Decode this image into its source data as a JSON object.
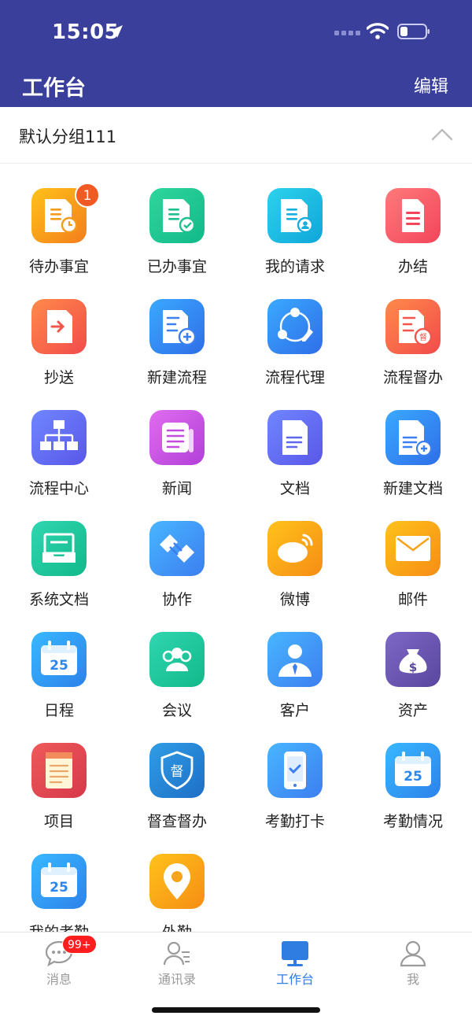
{
  "status_bar": {
    "time": "15:05",
    "icons": [
      "location-arrow-icon",
      "cellular-signal-icon",
      "wifi-icon",
      "battery-icon"
    ]
  },
  "nav": {
    "title": "工作台",
    "edit_label": "编辑"
  },
  "group": {
    "title": "默认分组111",
    "toggle_icon": "chevron-up-icon"
  },
  "apps": [
    {
      "label": "待办事宜",
      "icon": "todo-doc-clock-icon",
      "badge": "1"
    },
    {
      "label": "已办事宜",
      "icon": "done-doc-check-icon"
    },
    {
      "label": "我的请求",
      "icon": "request-doc-user-icon"
    },
    {
      "label": "办结",
      "icon": "finished-doc-icon"
    },
    {
      "label": "抄送",
      "icon": "cc-doc-arrow-icon"
    },
    {
      "label": "新建流程",
      "icon": "new-flow-plus-icon"
    },
    {
      "label": "流程代理",
      "icon": "flow-agent-icon"
    },
    {
      "label": "流程督办",
      "icon": "flow-supervise-icon"
    },
    {
      "label": "流程中心",
      "icon": "org-tree-icon"
    },
    {
      "label": "新闻",
      "icon": "newspaper-icon"
    },
    {
      "label": "文档",
      "icon": "document-icon"
    },
    {
      "label": "新建文档",
      "icon": "new-document-icon"
    },
    {
      "label": "系统文档",
      "icon": "inbox-tray-icon"
    },
    {
      "label": "协作",
      "icon": "handshake-icon"
    },
    {
      "label": "微博",
      "icon": "weibo-icon"
    },
    {
      "label": "邮件",
      "icon": "mail-envelope-icon"
    },
    {
      "label": "日程",
      "icon": "calendar-icon",
      "day": "25"
    },
    {
      "label": "会议",
      "icon": "meeting-people-icon"
    },
    {
      "label": "客户",
      "icon": "customer-icon"
    },
    {
      "label": "资产",
      "icon": "money-bag-icon"
    },
    {
      "label": "项目",
      "icon": "notepad-icon"
    },
    {
      "label": "督查督办",
      "icon": "shield-supervise-icon",
      "glyph": "督"
    },
    {
      "label": "考勤打卡",
      "icon": "phone-check-icon"
    },
    {
      "label": "考勤情况",
      "icon": "calendar-icon",
      "day": "25"
    },
    {
      "label": "我的考勤",
      "icon": "calendar-icon",
      "day": "25"
    },
    {
      "label": "外勤",
      "icon": "location-pin-icon"
    }
  ],
  "tabs": [
    {
      "label": "消息",
      "icon": "message-bubble-icon",
      "badge": "99+"
    },
    {
      "label": "通讯录",
      "icon": "contacts-icon"
    },
    {
      "label": "工作台",
      "icon": "workbench-monitor-icon",
      "active": true
    },
    {
      "label": "我",
      "icon": "profile-icon"
    }
  ],
  "colors": {
    "header_bg": "#3a3f9b",
    "active_tab": "#2f7de1",
    "inactive_tab": "#9a9a9a",
    "badge_orange": "#f15a22",
    "badge_red": "#ff1e1e"
  }
}
